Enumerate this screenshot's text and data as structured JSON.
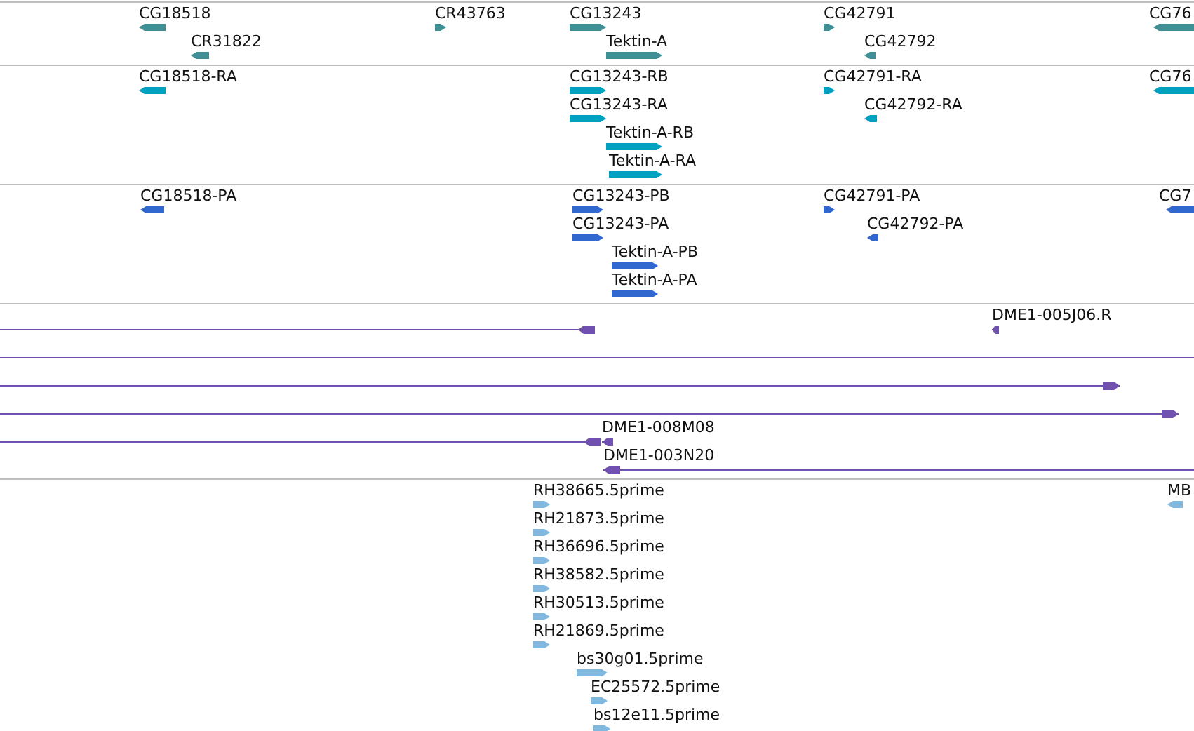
{
  "tracks": [
    {
      "kind": "gene",
      "color": "#3f8f95",
      "features": [
        {
          "label": "CG18518",
          "reverse": true
        },
        {
          "label": "CR31822",
          "reverse": true
        },
        {
          "label": "CR43763",
          "reverse": false
        },
        {
          "label": "CG13243",
          "reverse": false
        },
        {
          "label": "Tektin-A",
          "reverse": false
        },
        {
          "label": "CG42791",
          "reverse": false
        },
        {
          "label": "CG42792",
          "reverse": true
        },
        {
          "label": "CG76",
          "reverse": true
        }
      ]
    },
    {
      "kind": "gene",
      "color": "#00a0c0",
      "features": [
        {
          "label": "CG18518-RA",
          "reverse": true
        },
        {
          "label": "CG13243-RB",
          "reverse": false
        },
        {
          "label": "CG13243-RA",
          "reverse": false
        },
        {
          "label": "Tektin-A-RB",
          "reverse": false
        },
        {
          "label": "Tektin-A-RA",
          "reverse": false
        },
        {
          "label": "CG42791-RA",
          "reverse": false
        },
        {
          "label": "CG42792-RA",
          "reverse": true
        },
        {
          "label": "CG76",
          "reverse": true
        }
      ]
    },
    {
      "kind": "gene",
      "color": "#3068d0",
      "features": [
        {
          "label": "CG18518-PA",
          "reverse": true
        },
        {
          "label": "CG13243-PB",
          "reverse": false
        },
        {
          "label": "CG13243-PA",
          "reverse": false
        },
        {
          "label": "Tektin-A-PB",
          "reverse": false
        },
        {
          "label": "Tektin-A-PA",
          "reverse": false
        },
        {
          "label": "CG42791-PA",
          "reverse": false
        },
        {
          "label": "CG42792-PA",
          "reverse": true
        },
        {
          "label": "CG7",
          "reverse": true
        }
      ]
    },
    {
      "kind": "clone",
      "color": "#7050b0",
      "features": [
        {
          "kind": "clone",
          "reverse": true
        },
        {
          "kind": "clone",
          "label": "DME1-005J06.R",
          "reverse": true
        },
        {
          "kind": "line"
        },
        {
          "kind": "clone",
          "reverse": false
        },
        {
          "kind": "clone",
          "reverse": false
        },
        {
          "kind": "clone",
          "reverse": true
        },
        {
          "kind": "clone",
          "label": "DME1-008M08",
          "reverse": true
        },
        {
          "kind": "clone",
          "label": "DME1-003N20",
          "reverse": true
        }
      ]
    },
    {
      "kind": "gene",
      "color": "#80b8e0",
      "features": [
        {
          "label": "RH38665.5prime",
          "reverse": false
        },
        {
          "label": "RH21873.5prime",
          "reverse": false
        },
        {
          "label": "RH36696.5prime",
          "reverse": false
        },
        {
          "label": "RH38582.5prime",
          "reverse": false
        },
        {
          "label": "RH30513.5prime",
          "reverse": false
        },
        {
          "label": "RH21869.5prime",
          "reverse": false
        },
        {
          "label": "bs30g01.5prime",
          "reverse": false
        },
        {
          "label": "EC25572.5prime",
          "reverse": false
        },
        {
          "label": "bs12e11.5prime",
          "reverse": false
        },
        {
          "label": "MB",
          "reverse": true
        }
      ]
    }
  ]
}
